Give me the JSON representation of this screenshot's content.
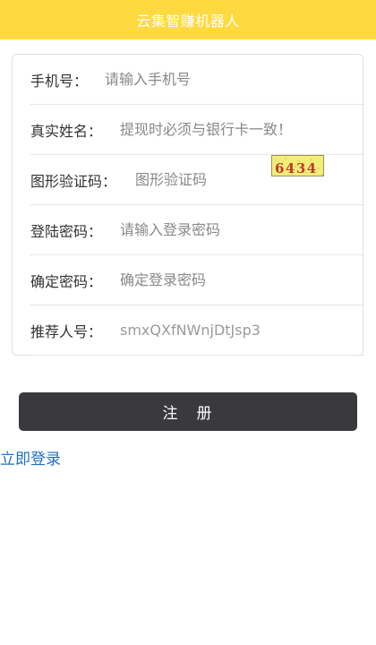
{
  "header": {
    "title": "云集智赚机器人"
  },
  "form": {
    "phone": {
      "label": "手机号：",
      "placeholder": "请输入手机号"
    },
    "realname": {
      "label": "真实姓名：",
      "placeholder": "提现时必须与银行卡一致！"
    },
    "captcha": {
      "label": "图形验证码：",
      "placeholder": "图形验证码",
      "image_text": "6434"
    },
    "password": {
      "label": "登陆密码：",
      "placeholder": "请输入登录密码"
    },
    "confirm": {
      "label": "确定密码：",
      "placeholder": "确定登录密码"
    },
    "referrer": {
      "label": "推荐人号：",
      "placeholder": "smxQXfNWnjDtJsp3"
    }
  },
  "actions": {
    "register_label": "注　册",
    "login_link": "立即登录"
  },
  "colors": {
    "header_bg": "#ffd940",
    "button_bg": "#3a3a3e",
    "link": "#1f6fc0"
  }
}
